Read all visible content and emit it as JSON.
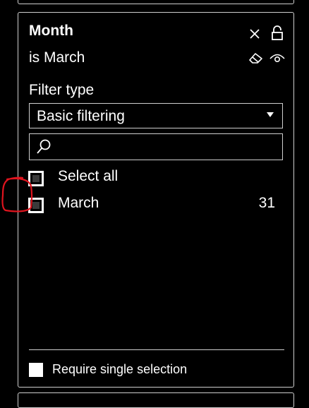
{
  "card": {
    "title": "Month",
    "summary": "is March",
    "icons": {
      "close": "close-icon",
      "lock": "lock-icon",
      "clear": "eraser-icon",
      "view": "eye-icon"
    }
  },
  "filter_type": {
    "label": "Filter type",
    "selected": "Basic filtering"
  },
  "search": {
    "placeholder": "",
    "value": ""
  },
  "list": {
    "select_all_label": "Select all",
    "items": [
      {
        "label": "March",
        "count": "31",
        "checked": true
      }
    ]
  },
  "footer": {
    "require_single_label": "Require single selection"
  },
  "colors": {
    "background": "#000000",
    "border": "#cfcfcf",
    "text": "#ffffff",
    "annotation": "#e0141e"
  }
}
